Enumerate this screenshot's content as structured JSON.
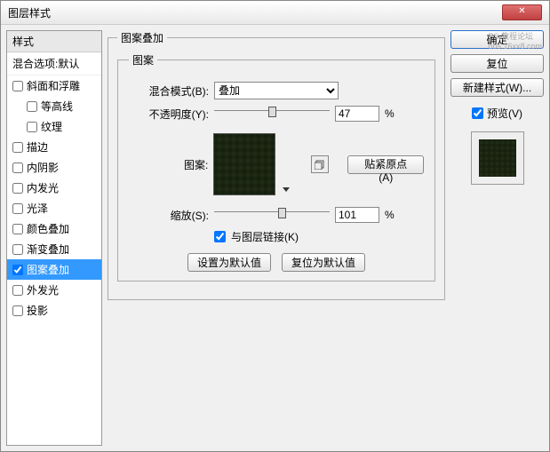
{
  "window": {
    "title": "图层样式"
  },
  "watermark": {
    "line1": "PS 教程论坛",
    "line2": "bbs.16xx8.com"
  },
  "styles_panel": {
    "header": "样式",
    "blend_defaults": "混合选项:默认",
    "items": [
      {
        "label": "斜面和浮雕",
        "checked": false,
        "indent": false
      },
      {
        "label": "等高线",
        "checked": false,
        "indent": true
      },
      {
        "label": "纹理",
        "checked": false,
        "indent": true
      },
      {
        "label": "描边",
        "checked": false,
        "indent": false
      },
      {
        "label": "内阴影",
        "checked": false,
        "indent": false
      },
      {
        "label": "内发光",
        "checked": false,
        "indent": false
      },
      {
        "label": "光泽",
        "checked": false,
        "indent": false
      },
      {
        "label": "颜色叠加",
        "checked": false,
        "indent": false
      },
      {
        "label": "渐变叠加",
        "checked": false,
        "indent": false
      },
      {
        "label": "图案叠加",
        "checked": true,
        "indent": false,
        "selected": true
      },
      {
        "label": "外发光",
        "checked": false,
        "indent": false
      },
      {
        "label": "投影",
        "checked": false,
        "indent": false
      }
    ]
  },
  "main": {
    "group_title": "图案叠加",
    "inner_title": "图案",
    "blend_mode_label": "混合模式(B):",
    "blend_mode_value": "叠加",
    "opacity_label": "不透明度(Y):",
    "opacity_value": "47",
    "opacity_unit": "%",
    "pattern_label": "图案:",
    "snap_origin_label": "贴紧原点(A)",
    "scale_label": "缩放(S):",
    "scale_value": "101",
    "scale_unit": "%",
    "link_with_layer_label": "与图层链接(K)",
    "link_with_layer_checked": true,
    "make_default_label": "设置为默认值",
    "reset_default_label": "复位为默认值"
  },
  "right": {
    "ok": "确定",
    "reset": "复位",
    "new_style": "新建样式(W)...",
    "preview_label": "预览(V)",
    "preview_checked": true
  }
}
